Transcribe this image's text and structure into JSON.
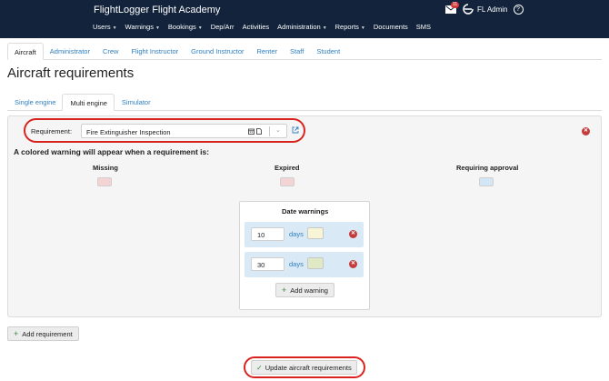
{
  "header": {
    "brand": "FlightLogger Flight Academy",
    "mail_badge": "11",
    "user": "FL Admin",
    "help_glyph": "?",
    "nav": [
      {
        "label": "Users",
        "dropdown": true
      },
      {
        "label": "Warnings",
        "dropdown": true
      },
      {
        "label": "Bookings",
        "dropdown": true
      },
      {
        "label": "Dep/Arr",
        "dropdown": false
      },
      {
        "label": "Activities",
        "dropdown": false
      },
      {
        "label": "Administration",
        "dropdown": true
      },
      {
        "label": "Reports",
        "dropdown": true
      },
      {
        "label": "Documents",
        "dropdown": false
      },
      {
        "label": "SMS",
        "dropdown": false
      }
    ]
  },
  "role_tabs": [
    "Aircraft",
    "Administrator",
    "Crew",
    "Flight Instructor",
    "Ground Instructor",
    "Renter",
    "Staff",
    "Student"
  ],
  "page_title": "Aircraft requirements",
  "engine_tabs": [
    "Single engine",
    "Multi engine",
    "Simulator"
  ],
  "requirement": {
    "label": "Requirement:",
    "value": "Fire Extinguisher Inspection"
  },
  "warning_text": "A colored warning will appear when a requirement is:",
  "columns": [
    {
      "label": "Missing",
      "color": "#f3d3d3"
    },
    {
      "label": "Expired",
      "color": "#f3d3d3"
    },
    {
      "label": "Requiring approval",
      "color": "#d4e6f5"
    }
  ],
  "date_warnings": {
    "title": "Date warnings",
    "rows": [
      {
        "days": "10",
        "unit": "days",
        "color": "#f7f5d6"
      },
      {
        "days": "30",
        "unit": "days",
        "color": "#dfe9c6"
      }
    ],
    "add_label": "Add warning"
  },
  "add_requirement_label": "Add requirement",
  "update_label": "Update aircraft requirements",
  "colors": {
    "header_bg": "#12233b",
    "link": "#2f7fbf",
    "highlight": "#d9231f",
    "row_bg": "#d9e9f6"
  }
}
